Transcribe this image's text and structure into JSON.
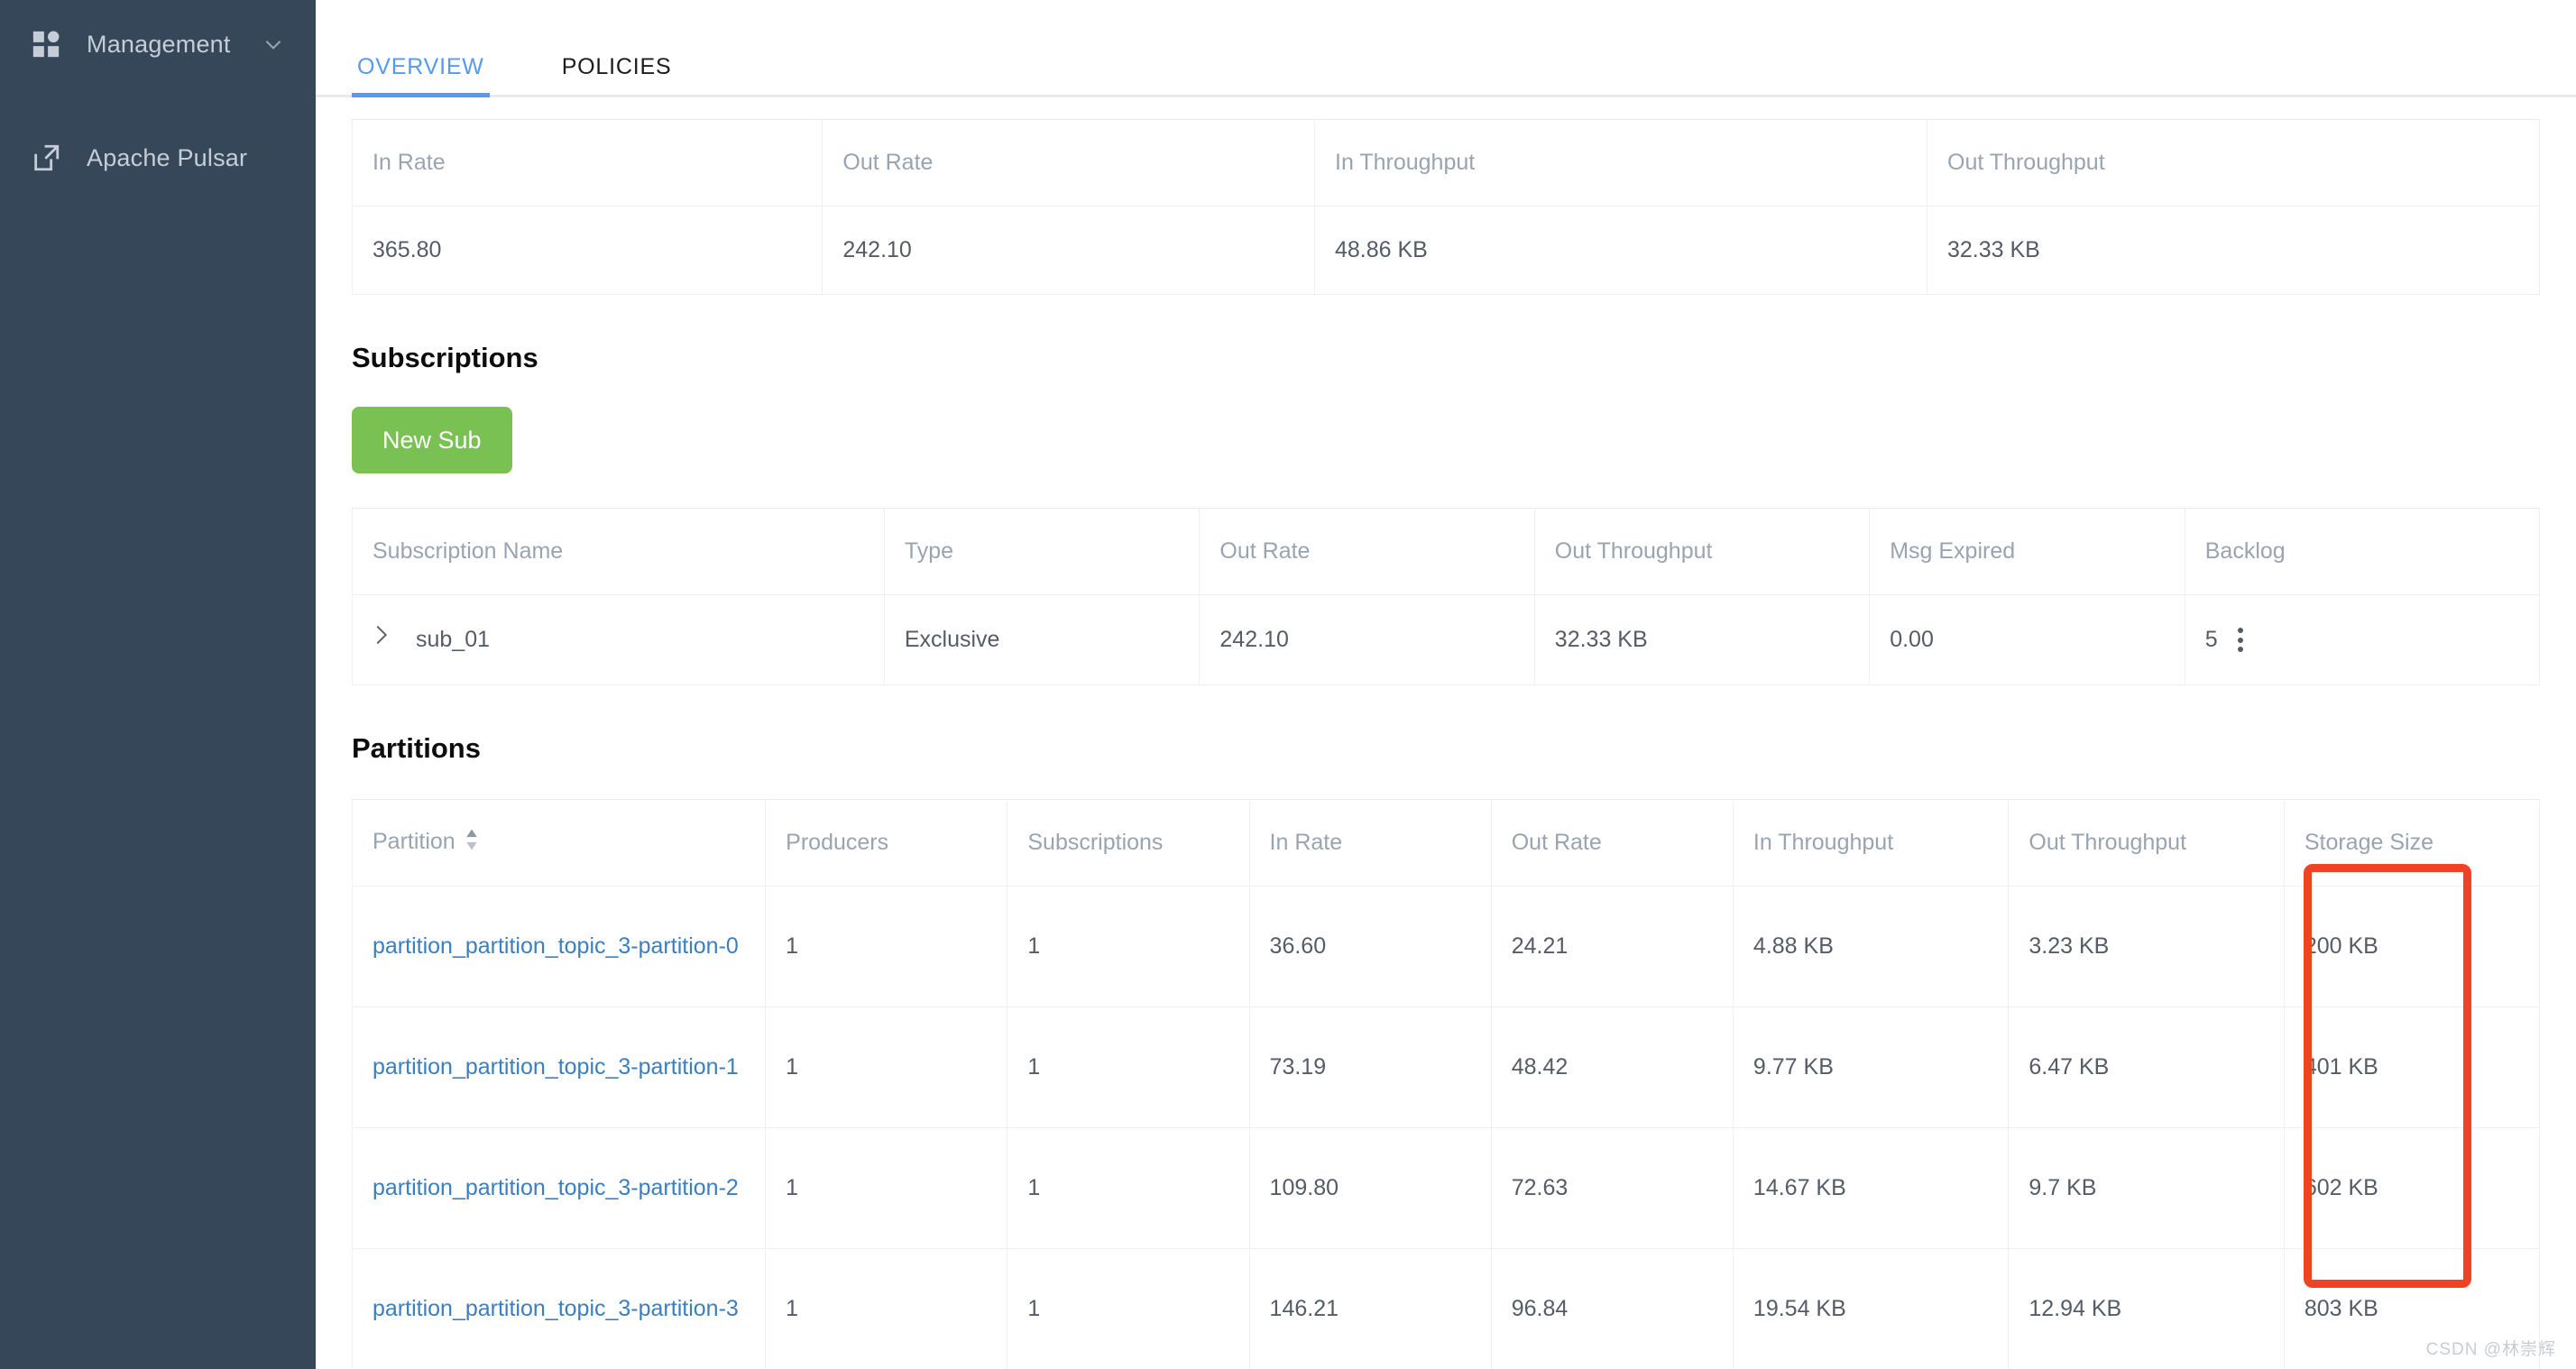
{
  "sidebar": {
    "items": [
      {
        "label": "Management",
        "icon": "grid-icon",
        "has_chevron": true
      },
      {
        "label": "Apache Pulsar",
        "icon": "external-link-icon",
        "has_chevron": false
      }
    ]
  },
  "tabs": [
    {
      "label": "OVERVIEW",
      "active": true
    },
    {
      "label": "POLICIES",
      "active": false
    }
  ],
  "stats_table": {
    "headers": [
      "In Rate",
      "Out Rate",
      "In Throughput",
      "Out Throughput"
    ],
    "row": [
      "365.80",
      "242.10",
      "48.86 KB",
      "32.33 KB"
    ]
  },
  "subscriptions": {
    "title": "Subscriptions",
    "new_sub_label": "New Sub",
    "headers": [
      "Subscription Name",
      "Type",
      "Out Rate",
      "Out Throughput",
      "Msg Expired",
      "Backlog"
    ],
    "rows": [
      {
        "name": "sub_01",
        "type": "Exclusive",
        "out_rate": "242.10",
        "out_throughput": "32.33 KB",
        "msg_expired": "0.00",
        "backlog": "5"
      }
    ]
  },
  "partitions": {
    "title": "Partitions",
    "headers": [
      "Partition",
      "Producers",
      "Subscriptions",
      "In Rate",
      "Out Rate",
      "In Throughput",
      "Out Throughput",
      "Storage Size"
    ],
    "sortable_column": "Partition",
    "rows": [
      {
        "partition": "partition_partition_topic_3-partition-0",
        "producers": "1",
        "subscriptions": "1",
        "in_rate": "36.60",
        "out_rate": "24.21",
        "in_throughput": "4.88 KB",
        "out_throughput": "3.23 KB",
        "storage_size": "200 KB"
      },
      {
        "partition": "partition_partition_topic_3-partition-1",
        "producers": "1",
        "subscriptions": "1",
        "in_rate": "73.19",
        "out_rate": "48.42",
        "in_throughput": "9.77 KB",
        "out_throughput": "6.47 KB",
        "storage_size": "401 KB"
      },
      {
        "partition": "partition_partition_topic_3-partition-2",
        "producers": "1",
        "subscriptions": "1",
        "in_rate": "109.80",
        "out_rate": "72.63",
        "in_throughput": "14.67 KB",
        "out_throughput": "9.7 KB",
        "storage_size": "602 KB"
      },
      {
        "partition": "partition_partition_topic_3-partition-3",
        "producers": "1",
        "subscriptions": "1",
        "in_rate": "146.21",
        "out_rate": "96.84",
        "in_throughput": "19.54 KB",
        "out_throughput": "12.94 KB",
        "storage_size": "803 KB"
      }
    ]
  },
  "annotation": {
    "shape": "rectangle",
    "color": "#f04323",
    "target_column": "Storage Size"
  },
  "watermark": "CSDN @林崇辉",
  "colors": {
    "sidebar_bg": "#37475a",
    "accent_blue": "#5599f3",
    "link_blue": "#3a7fc1",
    "button_green": "#7ac154",
    "annotation_red": "#f04323"
  }
}
